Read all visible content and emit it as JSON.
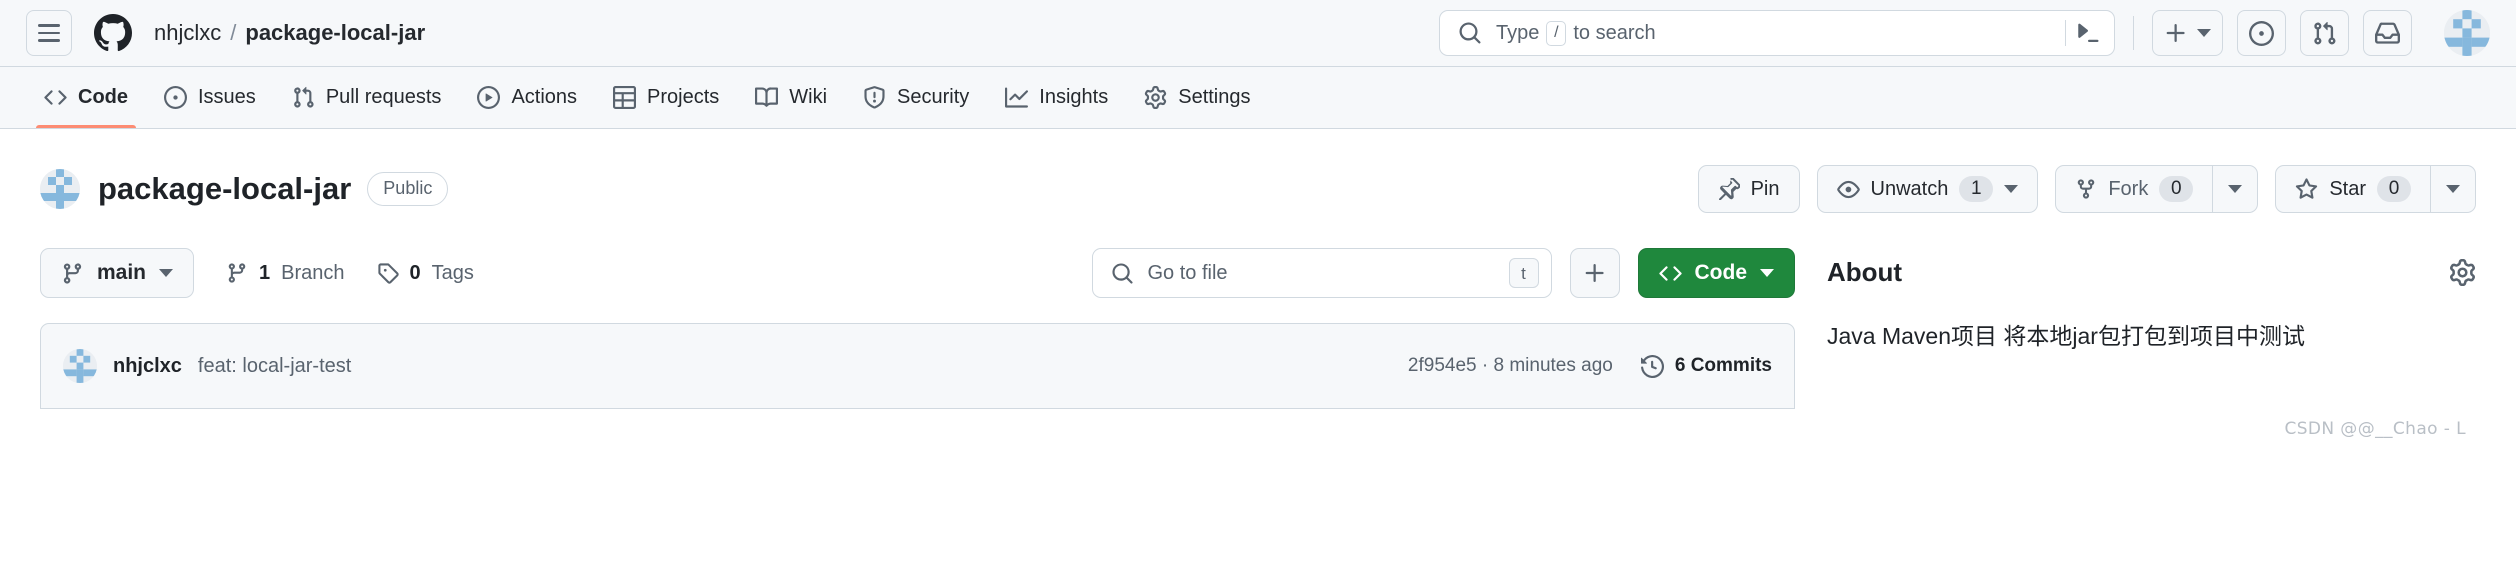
{
  "header": {
    "menu_icon": "hamburger-icon",
    "logo_icon": "github-logo-icon",
    "breadcrumb": {
      "owner": "nhjclxc",
      "separator": "/",
      "repo": "package-local-jar"
    },
    "search": {
      "icon": "search-icon",
      "placeholder_prefix": "Type",
      "placeholder_key": "/",
      "placeholder_suffix": "to search",
      "terminal_icon": "command-palette-icon"
    },
    "actions": [
      {
        "name": "create-new-button",
        "icon": "plus-icon",
        "has_caret": true
      },
      {
        "name": "issues-button",
        "icon": "issue-opened-icon",
        "has_caret": false
      },
      {
        "name": "pull-requests-button",
        "icon": "git-pull-request-icon",
        "has_caret": false
      },
      {
        "name": "notifications-button",
        "icon": "inbox-icon",
        "has_caret": false
      }
    ],
    "avatar": "user-avatar"
  },
  "repo_nav": {
    "tabs": [
      {
        "label": "Code",
        "icon": "code-icon",
        "active": true
      },
      {
        "label": "Issues",
        "icon": "issue-opened-icon",
        "active": false
      },
      {
        "label": "Pull requests",
        "icon": "git-pull-request-icon",
        "active": false
      },
      {
        "label": "Actions",
        "icon": "play-icon",
        "active": false
      },
      {
        "label": "Projects",
        "icon": "table-icon",
        "active": false
      },
      {
        "label": "Wiki",
        "icon": "book-icon",
        "active": false
      },
      {
        "label": "Security",
        "icon": "shield-icon",
        "active": false
      },
      {
        "label": "Insights",
        "icon": "graph-icon",
        "active": false
      },
      {
        "label": "Settings",
        "icon": "gear-icon",
        "active": false
      }
    ]
  },
  "repo_title": {
    "avatar": "repo-owner-avatar",
    "name": "package-local-jar",
    "visibility": "Public",
    "pin_label": "Pin",
    "watch_label": "Unwatch",
    "watch_count": "1",
    "fork_label": "Fork",
    "fork_count": "0",
    "star_label": "Star",
    "star_count": "0"
  },
  "file_toolbar": {
    "branch": "main",
    "branch_count": "1",
    "branch_word": "Branch",
    "tag_count": "0",
    "tag_word": "Tags",
    "go_to_file_placeholder": "Go to file",
    "go_to_file_kbd": "t",
    "add_file_icon": "plus-icon",
    "code_label": "Code"
  },
  "latest_commit": {
    "author": "nhjclxc",
    "message": "feat: local-jar-test",
    "sha": "2f954e5",
    "separator": "·",
    "relative_time": "8 minutes ago",
    "commits_label": "6 Commits"
  },
  "about": {
    "title": "About",
    "settings_icon": "gear-icon",
    "description": "Java Maven项目 将本地jar包打包到项目中测试"
  },
  "watermark": "CSDN @@__Chao - L",
  "colors": {
    "accent_green": "#1f883d",
    "active_tab_underline": "#fd8c73",
    "header_bg": "#f6f8fa",
    "border": "#d1d9e0",
    "text_primary": "#1f2328",
    "text_muted": "#59636e"
  }
}
